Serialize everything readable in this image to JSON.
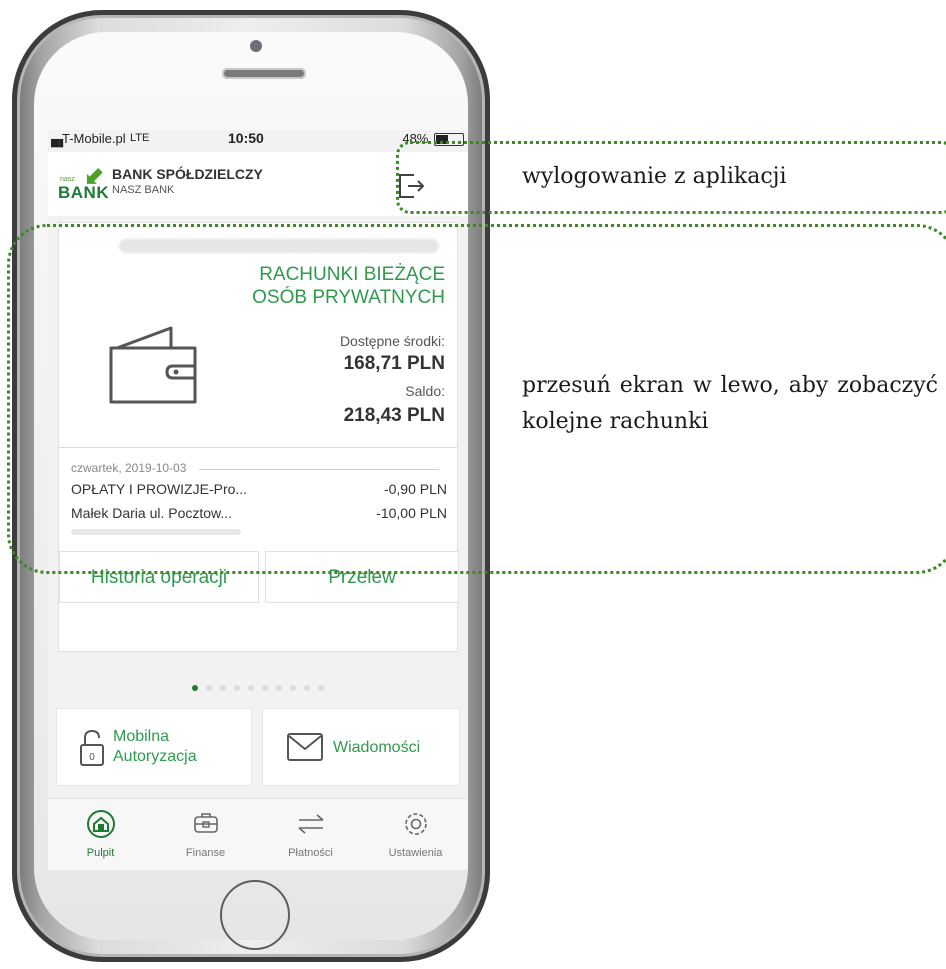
{
  "status_bar": {
    "carrier": "T-Mobile.pl",
    "network": "LTE",
    "time": "10:50",
    "battery": "48%"
  },
  "header": {
    "logo_small": "nasz",
    "logo_big": "BANK",
    "bank_name": "BANK SPÓŁDZIELCZY",
    "bank_subtitle": "NASZ BANK"
  },
  "account": {
    "type_line1": "RACHUNKI BIEŻĄCE",
    "type_line2": "OSÓB PRYWATNYCH",
    "available_label": "Dostępne środki:",
    "available_value": "168,71 PLN",
    "balance_label": "Saldo:",
    "balance_value": "218,43 PLN"
  },
  "transactions": {
    "date": "czwartek, 2019-10-03",
    "items": [
      {
        "title": "OPŁATY I PROWIZJE-Pro...",
        "amount": "-0,90 PLN"
      },
      {
        "title": "Małek Daria  ul. Pocztow...",
        "amount": "-10,00 PLN"
      }
    ]
  },
  "actions": {
    "history": "Historia operacji",
    "transfer": "Przelew"
  },
  "pager": {
    "total": 10,
    "active": 0
  },
  "tiles": {
    "auth_line1": "Mobilna",
    "auth_line2": "Autoryzacja",
    "messages": "Wiadomości"
  },
  "tabs": [
    {
      "label": "Pulpit",
      "icon": "home-icon"
    },
    {
      "label": "Finanse",
      "icon": "wallet-icon"
    },
    {
      "label": "Płatności",
      "icon": "transfer-arrows-icon"
    },
    {
      "label": "Ustawienia",
      "icon": "gear-icon"
    }
  ],
  "annotations": {
    "logout": "wylogowanie z aplikacji",
    "swipe": "przesuń ekran w lewo, aby zobaczyć kolejne rachunki"
  },
  "colors": {
    "accent": "#2f9a4e",
    "annotation": "#3b8a26"
  }
}
